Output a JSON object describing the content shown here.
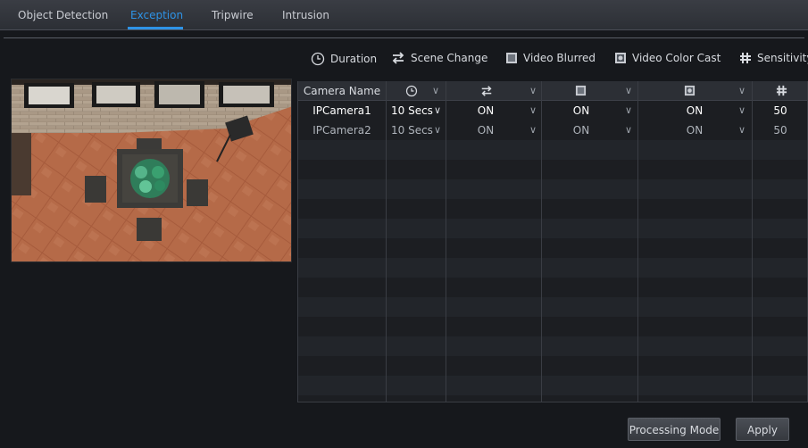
{
  "tabs": [
    {
      "label": "Object Detection"
    },
    {
      "label": "Exception"
    },
    {
      "label": "Tripwire"
    },
    {
      "label": "Intrusion"
    }
  ],
  "active_tab": "Exception",
  "options": {
    "duration": "Duration",
    "scene_change": "Scene Change",
    "video_blurred": "Video Blurred",
    "video_color_cast": "Video Color Cast",
    "sensitivity": "Sensitivity"
  },
  "table": {
    "header": {
      "camera_name": "Camera Name"
    },
    "rows": [
      {
        "camera": "IPCamera1",
        "duration": "10 Secs",
        "scene_change": "ON",
        "video_blurred": "ON",
        "video_color_cast": "ON",
        "sensitivity": "50"
      },
      {
        "camera": "IPCamera2",
        "duration": "10 Secs",
        "scene_change": "ON",
        "video_blurred": "ON",
        "video_color_cast": "ON",
        "sensitivity": "50"
      }
    ]
  },
  "buttons": {
    "processing_mode": "Processing Mode",
    "apply": "Apply"
  },
  "colors": {
    "accent": "#2e93e6",
    "background": "#16181c"
  }
}
